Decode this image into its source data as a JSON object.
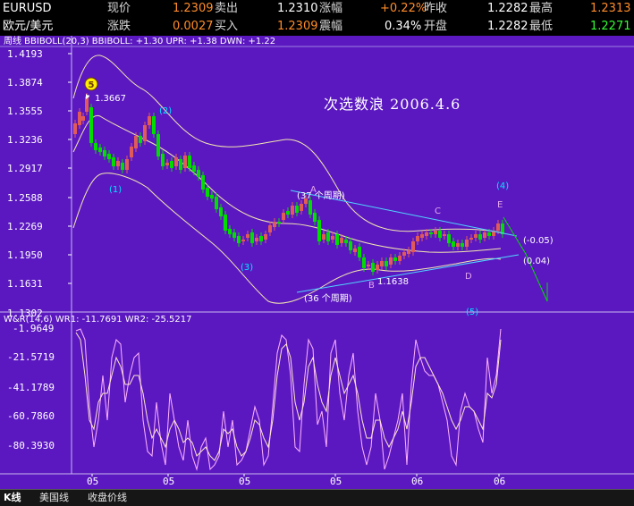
{
  "quote": {
    "symbol": "EURUSD",
    "name": "欧元/美元",
    "rows": [
      [
        {
          "label": "现价",
          "value": "1.2309"
        },
        {
          "label": "卖出",
          "value": "1.2310"
        },
        {
          "label": "涨幅",
          "value": "+0.22%"
        },
        {
          "label": "昨收",
          "value": "1.2282"
        },
        {
          "label": "最高",
          "value": "1.2313"
        }
      ],
      [
        {
          "label": "涨跌",
          "value": "0.0027"
        },
        {
          "label": "买入",
          "value": "1.2309"
        },
        {
          "label": "震幅",
          "value": "0.34%"
        },
        {
          "label": "开盘",
          "value": "1.2282"
        },
        {
          "label": "最低",
          "value": "1.2271"
        }
      ]
    ]
  },
  "price_panel": {
    "header": "周线  BBIBOLL(20,3) BBIBOLL: +1.30 UPR: +1.38 DWN: +1.22",
    "y_ticks": [
      "1.4193",
      "1.3874",
      "1.3555",
      "1.3236",
      "1.2917",
      "1.2588",
      "1.2269",
      "1.1950",
      "1.1631",
      "1.1302"
    ],
    "title": "次选数浪    2006.4.6",
    "annotations": {
      "high_price": "1.3667",
      "low_price": "1.1638",
      "wave_labels": [
        "5",
        "(1)",
        "(2)",
        "(3)",
        "(4)",
        "(5)"
      ],
      "sub_labels": [
        "A",
        "B",
        "C",
        "D",
        "E"
      ],
      "period_upper": "(37 个周期)",
      "period_lower": "(36 个周期)",
      "offset_upper": "(-0.05)",
      "offset_lower": "(0.04)"
    }
  },
  "wr_panel": {
    "header": "W&R(14,6)  WR1: -11.7691  WR2: -25.5217",
    "y_ticks": [
      "-1.9649",
      "-21.5719",
      "-41.1789",
      "-60.7860",
      "-80.3930"
    ]
  },
  "x_ticks": [
    "05",
    "05",
    "05",
    "05",
    "06",
    "06"
  ],
  "tabs": {
    "kline": "K线",
    "us_index": "美国线",
    "close_line": "收盘价线"
  },
  "colors": {
    "chart_bg": "#5b18c0",
    "up_candle": "#e05a5a",
    "down_candle": "#00dd00",
    "band": "#f3e7b0",
    "trendline": "#4fd6ff",
    "label_cyan": "#00e5ff",
    "label_purple": "#e4a6ee",
    "wr1": "#ffb4ff",
    "wr2": "#ffe6c8"
  }
}
